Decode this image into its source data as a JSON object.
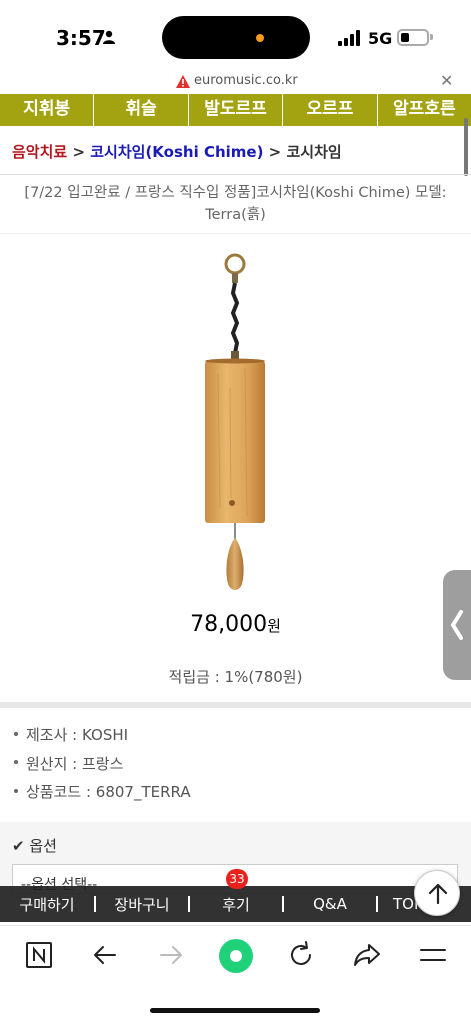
{
  "status_bar": {
    "time": "3:57",
    "network": "5G"
  },
  "url_bar": {
    "domain": "euromusic.co.kr"
  },
  "menu": {
    "items": [
      "지휘봉",
      "휘슬",
      "발도르프",
      "오르프",
      "알프호른"
    ]
  },
  "breadcrumb": {
    "root": "음악치료",
    "separator": ">",
    "category": "코시차임(Koshi Chime)",
    "current": "코시차임"
  },
  "product": {
    "title": "[7/22 입고완료 / 프랑스 직수입 정품]코시차임(Koshi Chime) 모델: Terra(흙)",
    "price": "78,000",
    "price_unit": "원",
    "points": "적립금 : 1%(780원)",
    "info": [
      {
        "label": "제조사 : KOSHI"
      },
      {
        "label": "원산지 : 프랑스"
      },
      {
        "label": "상품코드 : 6807_TERRA"
      }
    ]
  },
  "options": {
    "label": "옵션",
    "select_value": "--옵션 선택--"
  },
  "buy_bar": {
    "items": [
      "구매하기",
      "장바구니",
      "후기",
      "Q&A",
      "TOP"
    ],
    "review_count": "33"
  },
  "icons": {
    "side_tab": "chevron-left-icon",
    "scroll_top": "arrow-up-icon"
  },
  "colors": {
    "menu_bg": "#a3a312",
    "breadcrumb_root": "#b3161c",
    "breadcrumb_category": "#1a1ab8",
    "badge": "#e8211d",
    "browser_accent": "#1fd27a"
  }
}
